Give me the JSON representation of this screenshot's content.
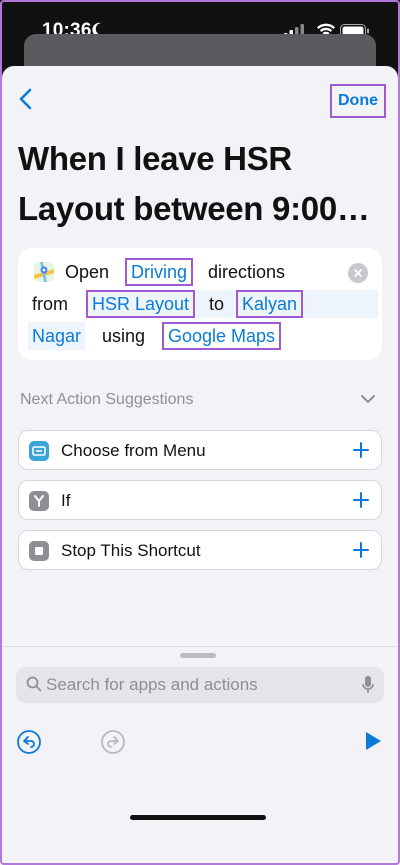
{
  "status_bar": {
    "time": "10:36"
  },
  "nav": {
    "done_label": "Done"
  },
  "title": "When I leave HSR Layout between 9:00…",
  "action": {
    "open": "Open",
    "mode": "Driving",
    "directions": "directions",
    "from": "from",
    "origin": "HSR Layout",
    "to": "to",
    "destination_line1": "Kalyan",
    "destination_line2": "Nagar",
    "using": "using",
    "app": "Google Maps"
  },
  "suggestions": {
    "header": "Next Action Suggestions",
    "items": [
      {
        "label": "Choose from Menu",
        "icon": "menu-icon",
        "color": "#3aa6d8"
      },
      {
        "label": "If",
        "icon": "if-branch-icon",
        "color": "#8e8e93"
      },
      {
        "label": "Stop This Shortcut",
        "icon": "stop-icon",
        "color": "#8e8e93"
      }
    ]
  },
  "search": {
    "placeholder": "Search for apps and actions"
  },
  "colors": {
    "accent": "#0a7bd8",
    "highlight": "#a05ad0"
  }
}
